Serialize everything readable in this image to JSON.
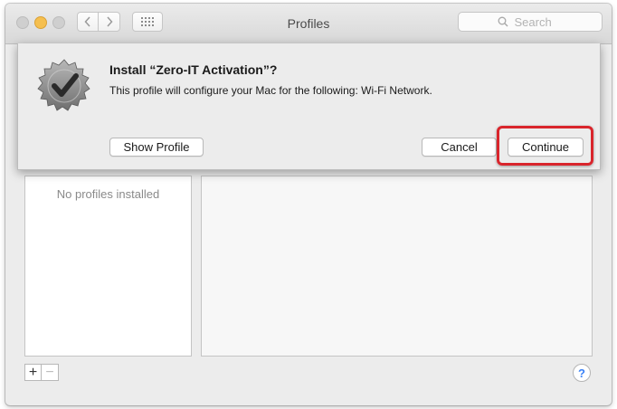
{
  "window": {
    "title": "Profiles",
    "search_placeholder": "Search"
  },
  "sheet": {
    "title": "Install “Zero-IT Activation”?",
    "description": "This profile will configure your Mac for the following: Wi-Fi Network.",
    "show_profile_label": "Show Profile",
    "cancel_label": "Cancel",
    "continue_label": "Continue",
    "highlight_color": "#d9252c"
  },
  "profiles_list": {
    "empty_text": "No profiles installed"
  },
  "footer": {
    "add_label": "+",
    "remove_label": "−",
    "help_label": "?"
  },
  "colors": {
    "minimize_yellow": "#f5bf4f",
    "help_blue": "#3b82f6"
  }
}
